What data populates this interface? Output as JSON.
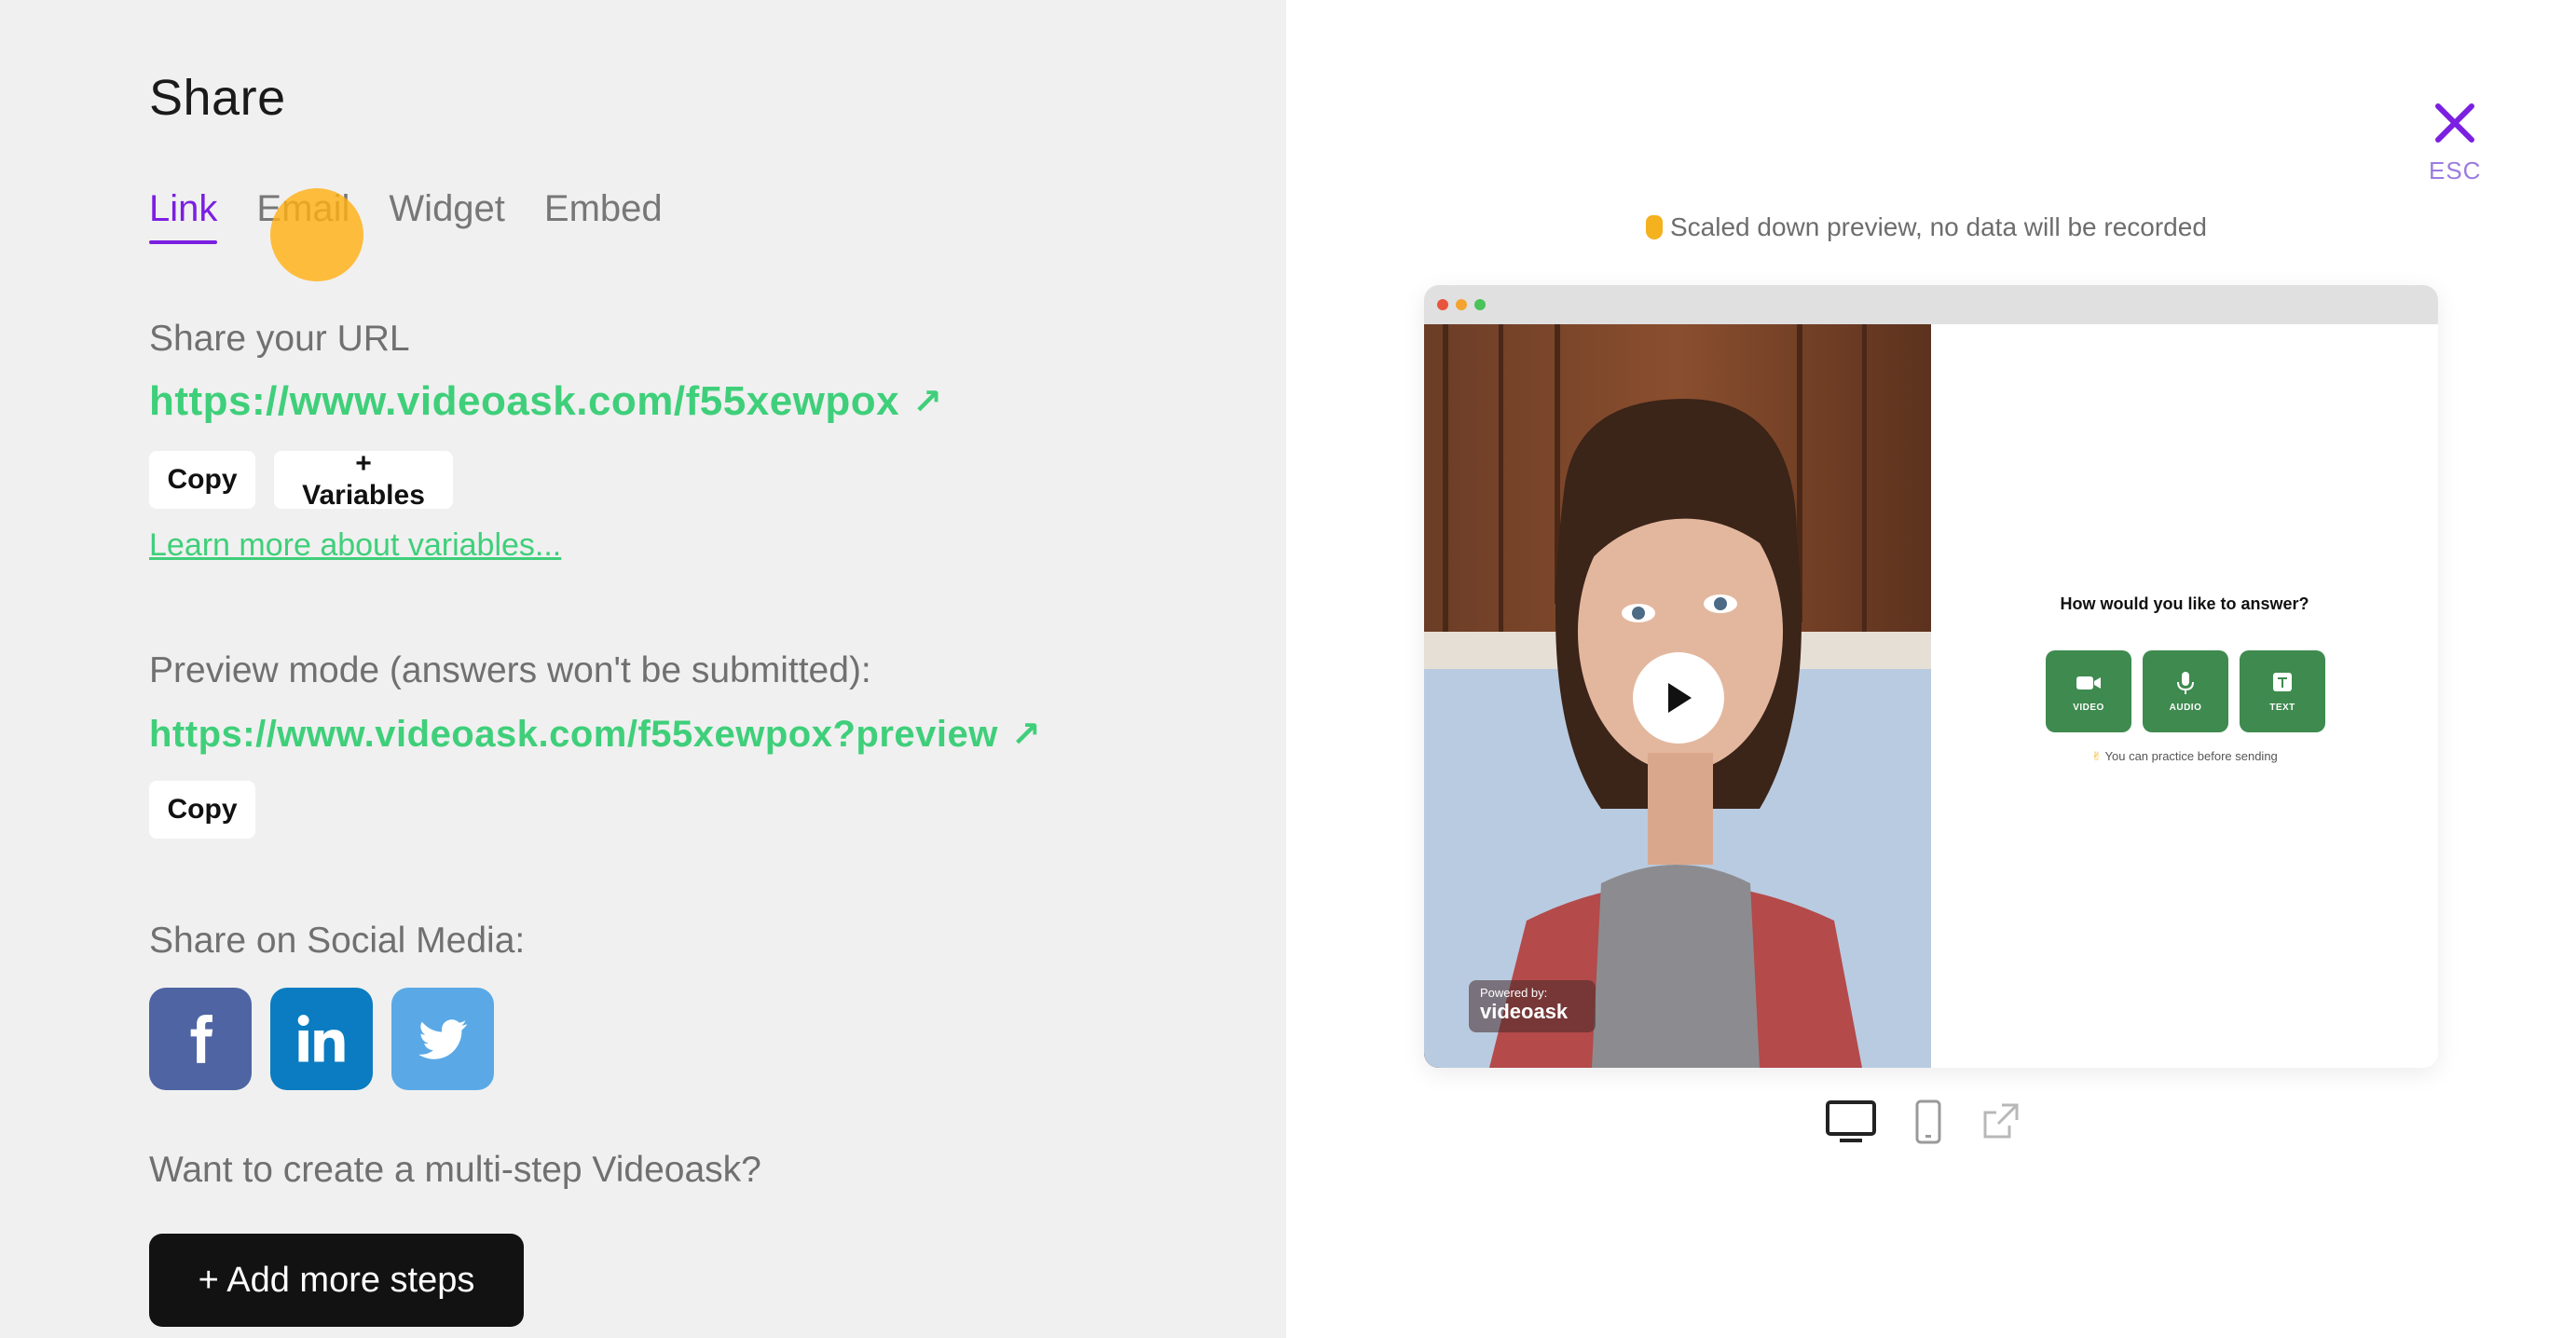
{
  "title": "Share",
  "tabs": [
    {
      "label": "Link",
      "active": true
    },
    {
      "label": "Email",
      "active": false
    },
    {
      "label": "Widget",
      "active": false
    },
    {
      "label": "Embed",
      "active": false
    }
  ],
  "share_url": {
    "label": "Share your URL",
    "url": "https://www.videoask.com/f55xewpox",
    "copy_label": "Copy",
    "variables_label": "+ Variables",
    "learn_more": "Learn more about variables..."
  },
  "preview_mode": {
    "label": "Preview mode (answers won't be submitted):",
    "url": "https://www.videoask.com/f55xewpox?preview",
    "copy_label": "Copy"
  },
  "social": {
    "label": "Share on Social Media:",
    "networks": [
      "facebook-icon",
      "linkedin-icon",
      "twitter-icon"
    ]
  },
  "multi_step": {
    "label": "Want to create a multi-step Videoask?",
    "button_label": "+ Add more steps"
  },
  "close": {
    "esc_label": "ESC"
  },
  "preview": {
    "note": "Scaled down preview, no data will be recorded",
    "question": "How would you like to answer?",
    "options": [
      "VIDEO",
      "AUDIO",
      "TEXT"
    ],
    "practice_note": "You can practice before sending",
    "powered_by": "Powered by:",
    "brand": "videoask"
  },
  "devices": [
    "desktop-icon",
    "mobile-icon",
    "open-external-icon"
  ],
  "colors": {
    "accent": "#7b1fe0",
    "link_green": "#3fcf7a",
    "option_green": "#3e8a4f",
    "facebook": "#4e64a3",
    "linkedin": "#0b7cc1",
    "twitter": "#5aa9e6"
  }
}
